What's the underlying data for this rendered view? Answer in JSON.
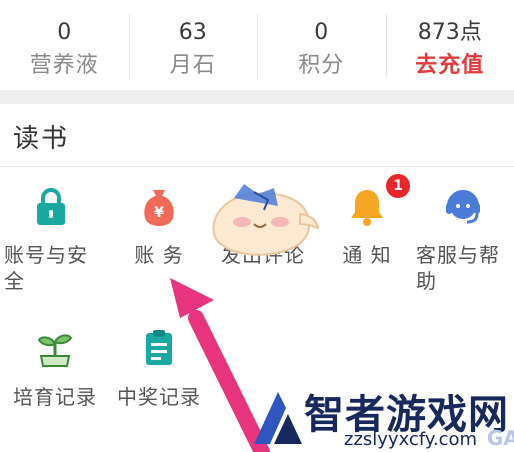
{
  "stats": [
    {
      "value": "0",
      "label": "营养液"
    },
    {
      "value": "63",
      "label": "月石"
    },
    {
      "value": "0",
      "label": "积分"
    },
    {
      "value": "873点",
      "label": "去充值"
    }
  ],
  "reading": {
    "title": "读书",
    "items": [
      {
        "label": "账号与安全",
        "icon": "lock-icon"
      },
      {
        "label": "账 务",
        "icon": "money-bag-icon"
      },
      {
        "label": "发出评论",
        "icon": "comment-icon"
      },
      {
        "label": "通 知",
        "icon": "bell-icon",
        "badge": "1"
      },
      {
        "label": "客服与帮助",
        "icon": "headset-icon"
      },
      {
        "label": "培育记录",
        "icon": "sprout-icon"
      },
      {
        "label": "中奖记录",
        "icon": "clipboard-icon"
      }
    ]
  },
  "watermark": {
    "title": "智者游戏网",
    "url": "zzslyyxcfy.com",
    "ghost": "GAME"
  },
  "colors": {
    "teal": "#1aa8a0",
    "coral": "#f06a5a",
    "orange": "#f5a623",
    "blue": "#4a7bd8",
    "recharge": "#e23b3b",
    "arrow": "#e8337f",
    "brand": "#16285c"
  }
}
